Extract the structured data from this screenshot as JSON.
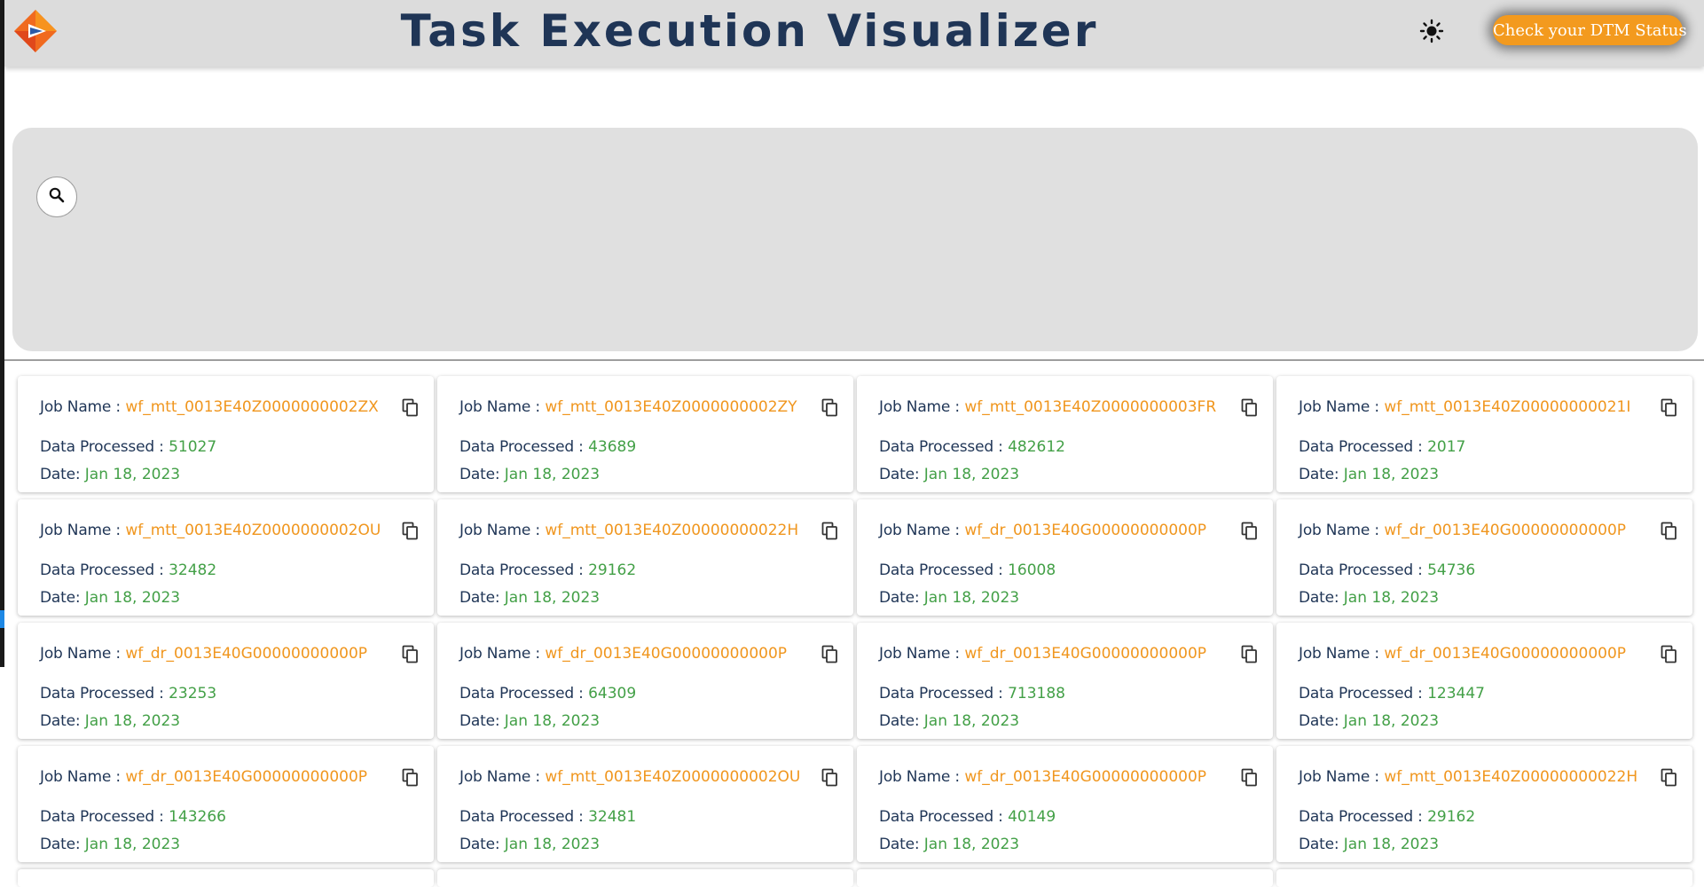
{
  "header": {
    "title": "Task Execution Visualizer",
    "logo_icon": "company-logo",
    "theme_icon": "sun-icon",
    "dtm_button": "Check your DTM Status",
    "accent": "#f39a1e",
    "title_color": "#1f3556"
  },
  "search": {
    "icon": "search-icon"
  },
  "labels": {
    "job_name": "Job Name :",
    "data_processed": "Data Processed :",
    "date": "Date:"
  },
  "cards": [
    {
      "job": "wf_mtt_0013E40Z0000000002ZX",
      "processed": "51027",
      "date": "Jan 18, 2023"
    },
    {
      "job": "wf_mtt_0013E40Z0000000002ZY",
      "processed": "43689",
      "date": "Jan 18, 2023"
    },
    {
      "job": "wf_mtt_0013E40Z0000000003FR",
      "processed": "482612",
      "date": "Jan 18, 2023"
    },
    {
      "job": "wf_mtt_0013E40Z00000000021I",
      "processed": "2017",
      "date": "Jan 18, 2023"
    },
    {
      "job": "wf_mtt_0013E40Z0000000002OU",
      "processed": "32482",
      "date": "Jan 18, 2023"
    },
    {
      "job": "wf_mtt_0013E40Z00000000022H",
      "processed": "29162",
      "date": "Jan 18, 2023"
    },
    {
      "job": "wf_dr_0013E40G00000000000P",
      "processed": "16008",
      "date": "Jan 18, 2023"
    },
    {
      "job": "wf_dr_0013E40G00000000000P",
      "processed": "54736",
      "date": "Jan 18, 2023"
    },
    {
      "job": "wf_dr_0013E40G00000000000P",
      "processed": "23253",
      "date": "Jan 18, 2023"
    },
    {
      "job": "wf_dr_0013E40G00000000000P",
      "processed": "64309",
      "date": "Jan 18, 2023"
    },
    {
      "job": "wf_dr_0013E40G00000000000P",
      "processed": "713188",
      "date": "Jan 18, 2023"
    },
    {
      "job": "wf_dr_0013E40G00000000000P",
      "processed": "123447",
      "date": "Jan 18, 2023"
    },
    {
      "job": "wf_dr_0013E40G00000000000P",
      "processed": "143266",
      "date": "Jan 18, 2023"
    },
    {
      "job": "wf_mtt_0013E40Z0000000002OU",
      "processed": "32481",
      "date": "Jan 18, 2023"
    },
    {
      "job": "wf_dr_0013E40G00000000000P",
      "processed": "40149",
      "date": "Jan 18, 2023"
    },
    {
      "job": "wf_mtt_0013E40Z00000000022H",
      "processed": "29162",
      "date": "Jan 18, 2023"
    }
  ],
  "colors": {
    "job_value": "#f0961e",
    "numeric_value": "#43a047",
    "label": "#1f3556"
  }
}
